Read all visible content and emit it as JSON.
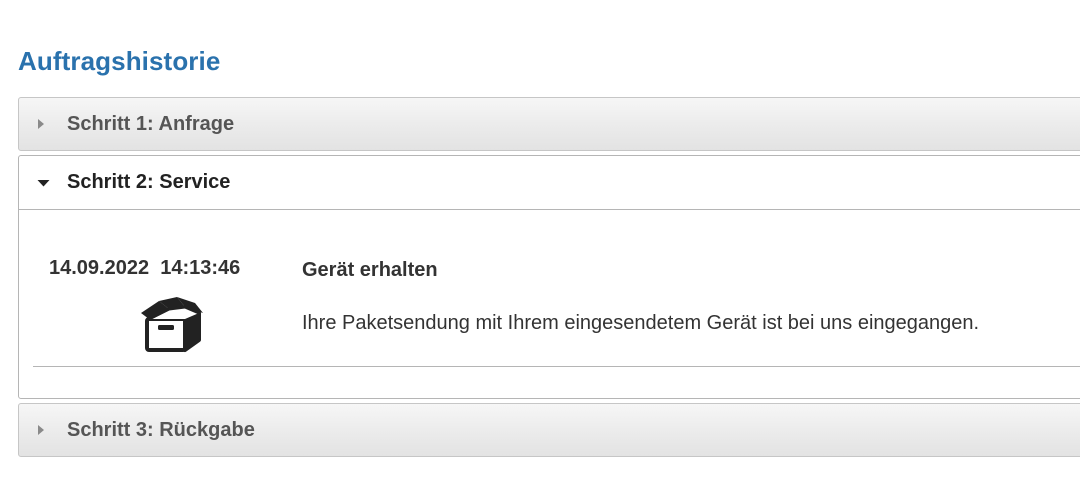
{
  "page": {
    "title": "Auftragshistorie"
  },
  "steps": [
    {
      "label": "Schritt 1: Anfrage",
      "state": "collapsed",
      "icon": "triangle-right-icon"
    },
    {
      "label": "Schritt 2: Service",
      "state": "expanded",
      "icon": "triangle-down-icon",
      "entries": [
        {
          "datetime": "14.09.2022  14:13:46",
          "icon": "package-received-icon",
          "title": "Gerät erhalten",
          "description": "Ihre Paketsendung mit Ihrem eingesendetem Gerät ist bei uns eingegangen."
        }
      ]
    },
    {
      "label": "Schritt 3: Rückgabe",
      "state": "collapsed",
      "icon": "triangle-right-icon"
    }
  ],
  "colors": {
    "title": "#2a72ad",
    "text": "#333333",
    "collapsed_text": "#555555",
    "border": "#c6c6c6"
  }
}
